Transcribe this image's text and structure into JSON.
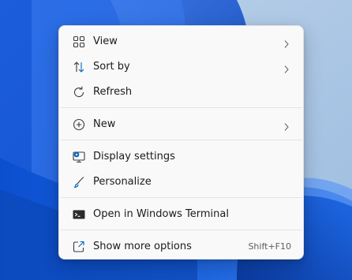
{
  "menu": {
    "items": [
      {
        "label": "View",
        "icon": "grid-icon",
        "submenu": true
      },
      {
        "label": "Sort by",
        "icon": "sort-icon",
        "submenu": true
      },
      {
        "label": "Refresh",
        "icon": "refresh-icon"
      },
      {
        "label": "New",
        "icon": "add-circle-icon",
        "submenu": true
      },
      {
        "label": "Display settings",
        "icon": "display-settings-icon"
      },
      {
        "label": "Personalize",
        "icon": "brush-icon"
      },
      {
        "label": "Open in Windows Terminal",
        "icon": "terminal-icon"
      },
      {
        "label": "Show more options",
        "icon": "share-icon",
        "shortcut": "Shift+F10"
      }
    ]
  },
  "colors": {
    "menu_background": "#f9f9f9",
    "text": "#1b1b1b",
    "accent_blue": "#0067c0",
    "wallpaper_blue": "#0a57d8"
  }
}
